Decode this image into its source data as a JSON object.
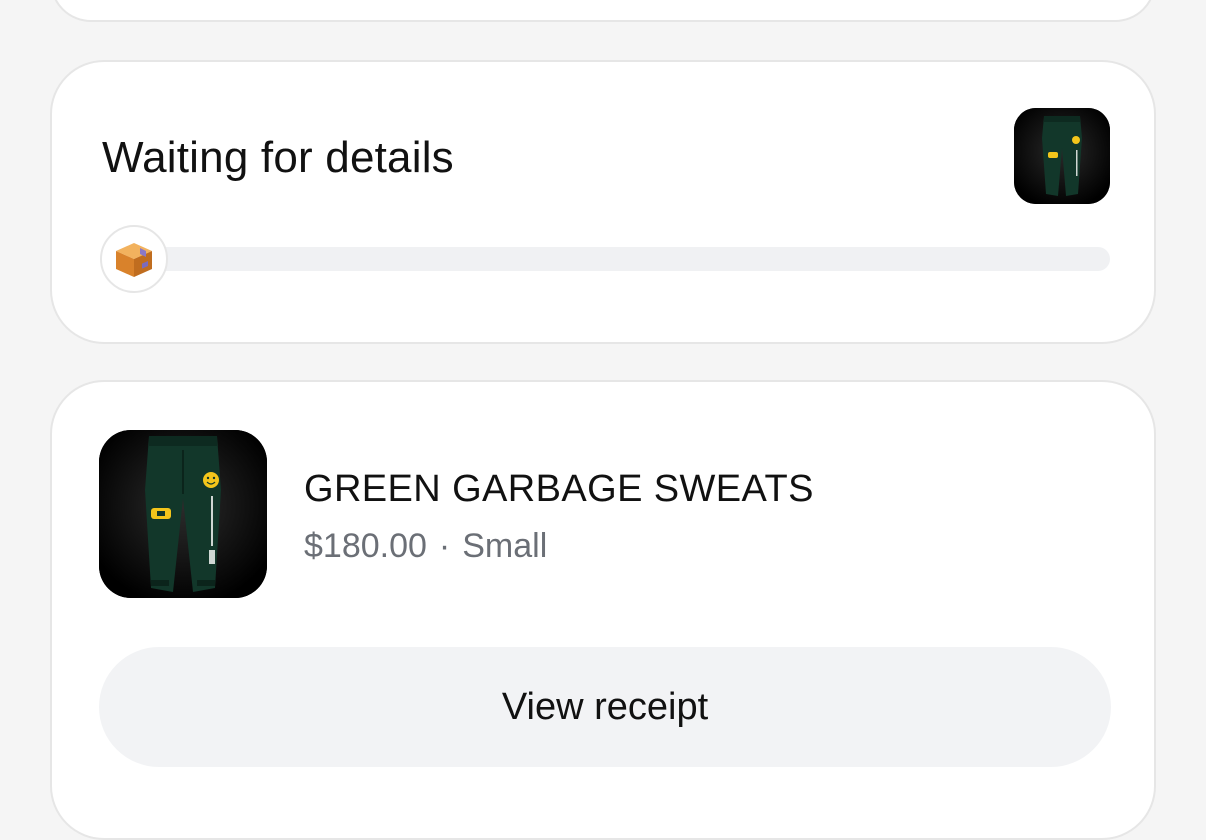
{
  "status": {
    "title": "Waiting for details",
    "progress_percent": 0,
    "badge_icon": "package-box-icon",
    "thumb_icon": "sweatpants-thumbnail"
  },
  "order": {
    "product_name": "GREEN GARBAGE SWEATS",
    "price": "$180.00",
    "separator": "·",
    "size": "Small",
    "thumb_icon": "sweatpants-thumbnail",
    "receipt_label": "View receipt"
  },
  "colors": {
    "page_background": "#f5f5f5",
    "card_background": "#ffffff",
    "button_background": "#f2f3f5",
    "product_green": "#12372a",
    "logo_yellow": "#f3c51b"
  }
}
